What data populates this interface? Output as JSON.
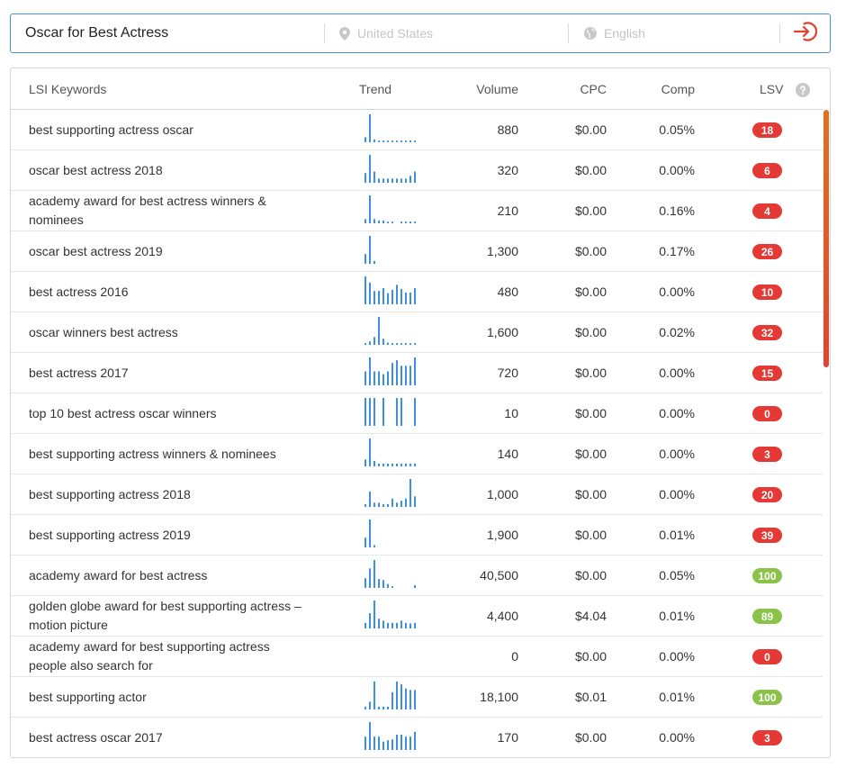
{
  "search": {
    "query": "Oscar for Best Actress",
    "location_placeholder": "United States",
    "language_placeholder": "English"
  },
  "icons": {
    "location": "map-pin-icon",
    "language": "globe-icon",
    "submit": "sign-in-arrow-icon",
    "help": "question-circle-icon"
  },
  "colors": {
    "accent_blue": "#4a90d9",
    "bar_blue": "#3d8fe0",
    "badge_red": "#e53935",
    "badge_green": "#8bc34a",
    "submit_red": "#e5402f",
    "scroll_top": "#e2711d",
    "scroll_bottom": "#e5402f"
  },
  "table": {
    "headers": {
      "keyword": "LSI Keywords",
      "trend": "Trend",
      "volume": "Volume",
      "cpc": "CPC",
      "comp": "Comp",
      "lsv": "LSV"
    },
    "rows": [
      {
        "keyword": "best supporting actress oscar",
        "volume": "880",
        "cpc": "$0.00",
        "comp": "0.05%",
        "lsv": "18",
        "lsv_level": "red",
        "trend": [
          0.18,
          1.0,
          0.1,
          0.06,
          0.06,
          0.06,
          0.06,
          0.06,
          0.06,
          0.06,
          0.06,
          0.06
        ]
      },
      {
        "keyword": "oscar best actress 2018",
        "volume": "320",
        "cpc": "$0.00",
        "comp": "0.00%",
        "lsv": "6",
        "lsv_level": "red",
        "trend": [
          0.35,
          1.0,
          0.4,
          0.15,
          0.15,
          0.15,
          0.15,
          0.15,
          0.15,
          0.15,
          0.25,
          0.4
        ]
      },
      {
        "keyword": "academy award for best actress winners & nominees",
        "volume": "210",
        "cpc": "$0.00",
        "comp": "0.16%",
        "lsv": "4",
        "lsv_level": "red",
        "trend": [
          0.15,
          1.0,
          0.15,
          0.1,
          0.1,
          0.06,
          0.06,
          0.0,
          0.06,
          0.06,
          0.06,
          0.06
        ]
      },
      {
        "keyword": "oscar best actress 2019",
        "volume": "1,300",
        "cpc": "$0.00",
        "comp": "0.17%",
        "lsv": "26",
        "lsv_level": "red",
        "trend": [
          0.35,
          1.0,
          0.1,
          0,
          0,
          0,
          0,
          0,
          0,
          0,
          0,
          0
        ]
      },
      {
        "keyword": "best actress 2016",
        "volume": "480",
        "cpc": "$0.00",
        "comp": "0.00%",
        "lsv": "10",
        "lsv_level": "red",
        "trend": [
          1.0,
          0.78,
          0.48,
          0.48,
          0.58,
          0.4,
          0.52,
          0.7,
          0.55,
          0.42,
          0.42,
          0.58
        ]
      },
      {
        "keyword": "oscar winners best actress",
        "volume": "1,600",
        "cpc": "$0.00",
        "comp": "0.02%",
        "lsv": "32",
        "lsv_level": "red",
        "trend": [
          0.06,
          0.12,
          0.28,
          1.0,
          0.22,
          0.08,
          0.06,
          0.06,
          0.06,
          0.06,
          0.06,
          0.06
        ]
      },
      {
        "keyword": "best actress 2017",
        "volume": "720",
        "cpc": "$0.00",
        "comp": "0.00%",
        "lsv": "15",
        "lsv_level": "red",
        "trend": [
          0.5,
          1.0,
          0.5,
          0.5,
          0.4,
          0.5,
          0.8,
          0.9,
          0.7,
          0.7,
          0.7,
          1.0
        ]
      },
      {
        "keyword": "top 10 best actress oscar winners",
        "volume": "10",
        "cpc": "$0.00",
        "comp": "0.00%",
        "lsv": "0",
        "lsv_level": "red",
        "trend": [
          1.0,
          1.0,
          1.0,
          0,
          1.0,
          0,
          0,
          1.0,
          1.0,
          0,
          0,
          1.0
        ]
      },
      {
        "keyword": "best supporting actress winners & nominees",
        "volume": "140",
        "cpc": "$0.00",
        "comp": "0.00%",
        "lsv": "3",
        "lsv_level": "red",
        "trend": [
          0.25,
          1.0,
          0.2,
          0.1,
          0.1,
          0.1,
          0.1,
          0.1,
          0.1,
          0.1,
          0.1,
          0.1
        ]
      },
      {
        "keyword": "best supporting actress 2018",
        "volume": "1,000",
        "cpc": "$0.00",
        "comp": "0.00%",
        "lsv": "20",
        "lsv_level": "red",
        "trend": [
          0.1,
          0.55,
          0.15,
          0.15,
          0.1,
          0.1,
          0.3,
          0.15,
          0.22,
          0.3,
          1.0,
          0.38
        ]
      },
      {
        "keyword": "best supporting actress 2019",
        "volume": "1,900",
        "cpc": "$0.00",
        "comp": "0.01%",
        "lsv": "39",
        "lsv_level": "red",
        "trend": [
          0.35,
          1.0,
          0.08,
          0,
          0,
          0,
          0,
          0,
          0,
          0,
          0,
          0
        ]
      },
      {
        "keyword": "academy award for best actress",
        "volume": "40,500",
        "cpc": "$0.00",
        "comp": "0.05%",
        "lsv": "100",
        "lsv_level": "green",
        "trend": [
          0.35,
          0.7,
          1.0,
          0.32,
          0.28,
          0.14,
          0.06,
          0,
          0,
          0,
          0,
          0.1
        ]
      },
      {
        "keyword": "golden globe award for best supporting actress – motion picture",
        "volume": "4,400",
        "cpc": "$4.04",
        "comp": "0.01%",
        "lsv": "89",
        "lsv_level": "green",
        "trend": [
          0.2,
          0.55,
          1.0,
          0.35,
          0.28,
          0.2,
          0.2,
          0.2,
          0.28,
          0.2,
          0.18,
          0.2
        ]
      },
      {
        "keyword": "academy award for best supporting actress people also search for",
        "volume": "0",
        "cpc": "$0.00",
        "comp": "0.00%",
        "lsv": "0",
        "lsv_level": "red",
        "trend": []
      },
      {
        "keyword": "best supporting actor",
        "volume": "18,100",
        "cpc": "$0.01",
        "comp": "0.01%",
        "lsv": "100",
        "lsv_level": "green",
        "trend": [
          0.1,
          0.28,
          1.0,
          0.1,
          0.1,
          0.1,
          0.62,
          1.0,
          0.9,
          0.75,
          0.7,
          0.7
        ]
      },
      {
        "keyword": "best actress oscar 2017",
        "volume": "170",
        "cpc": "$0.00",
        "comp": "0.00%",
        "lsv": "3",
        "lsv_level": "red",
        "trend": [
          0.48,
          1.0,
          0.48,
          0.48,
          0.3,
          0.35,
          0.38,
          0.55,
          0.55,
          0.48,
          0.48,
          0.65
        ]
      }
    ]
  }
}
